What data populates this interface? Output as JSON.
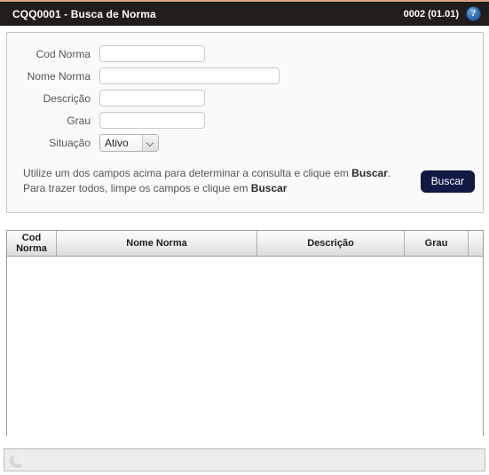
{
  "titlebar": {
    "title": "CQQ0001 - Busca de Norma",
    "version": "0002 (01.01)",
    "help_icon": "help-question-icon",
    "help_glyph": "?",
    "background_color": "#211d1a",
    "accent_color": "#d9a384"
  },
  "form": {
    "fields": [
      {
        "label": "Cod Norma",
        "value": "",
        "placeholder": "",
        "type": "text",
        "width": "short"
      },
      {
        "label": "Nome Norma",
        "value": "",
        "placeholder": "",
        "type": "text",
        "width": "long"
      },
      {
        "label": "Descrição",
        "value": "",
        "placeholder": "",
        "type": "text",
        "width": "short"
      },
      {
        "label": "Grau",
        "value": "",
        "placeholder": "",
        "type": "text",
        "width": "short"
      }
    ],
    "situacao": {
      "label": "Situação",
      "selected": "Ativo",
      "options": [
        "Ativo"
      ],
      "arrow_icon": "chevron-down-icon"
    },
    "hint": {
      "line1_part1": "Utilize um dos campos acima para determinar a consulta e clique em ",
      "line1_strong": "Buscar",
      "line1_part2": ".",
      "line2_part1": "Para trazer todos, limpe os campos e clique em ",
      "line2_strong": "Buscar"
    },
    "search_button": {
      "label": "Buscar",
      "color": "#111a44"
    }
  },
  "results": {
    "columns": [
      {
        "label": "Cod Norma",
        "key": "cod"
      },
      {
        "label": "Nome Norma",
        "key": "nome"
      },
      {
        "label": "Descrição",
        "key": "desc"
      },
      {
        "label": "Grau",
        "key": "grau"
      }
    ],
    "rows": []
  },
  "status_bar": {
    "spinner_icon": "loading-spinner-icon",
    "message": ""
  }
}
